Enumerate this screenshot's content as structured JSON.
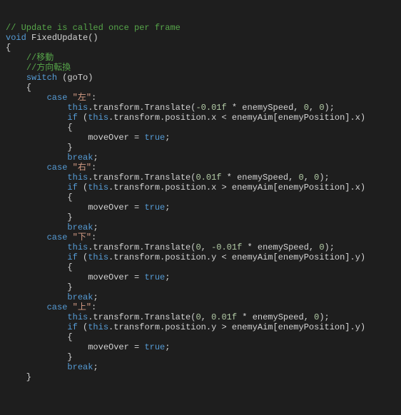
{
  "comment_header": "// Update is called once per frame",
  "kw_void": "void",
  "fn_name": " FixedUpdate()",
  "brace_open": "{",
  "brace_close": "}",
  "brace_open2": "{",
  "brace_close2": "}",
  "brace_close_sw": "}",
  "comment_move": "//移動",
  "comment_turn": "//方向転換",
  "kw_switch": "switch",
  "switch_expr": " (goTo)",
  "kw_case": "case",
  "kw_break": "break",
  "kw_this": "this",
  "kw_if": "if",
  "kw_true": "true",
  "semi": ";",
  "colon": ":",
  "space": " ",
  "case_left_str": "\"左\"",
  "case_right_str": "\"右\"",
  "case_down_str": "\"下\"",
  "case_up_str": "\"上\"",
  "translate_prefix": ".transform.Translate(",
  "translate_left_args_a": "-0.01f",
  "translate_left_args_b": " * enemySpeed, ",
  "translate_left_args_c": "0",
  "translate_left_args_d": ", ",
  "translate_left_args_e": "0",
  "translate_close": ");",
  "translate_right_args_a": "0.01f",
  "translate_down_args_pre": "0",
  "translate_down_args_mid": ", ",
  "translate_down_args_a": "-0.01f",
  "translate_down_args_b": " * enemySpeed, ",
  "translate_down_args_c": "0",
  "translate_up_args_a": "0.01f",
  "if_open": " (",
  "if_pos_x": ".transform.position.x ",
  "if_pos_y": ".transform.position.y ",
  "if_lt": "< enemyAim[enemyPosition].x)",
  "if_gt": "> enemyAim[enemyPosition].x)",
  "if_lt_y": "< enemyAim[enemyPosition].y)",
  "if_gt_y": "> enemyAim[enemyPosition].y)",
  "moveover_assign": "moveOver = ",
  "ind1": "    ",
  "ind2": "        ",
  "ind3": "            ",
  "ind4": "                "
}
